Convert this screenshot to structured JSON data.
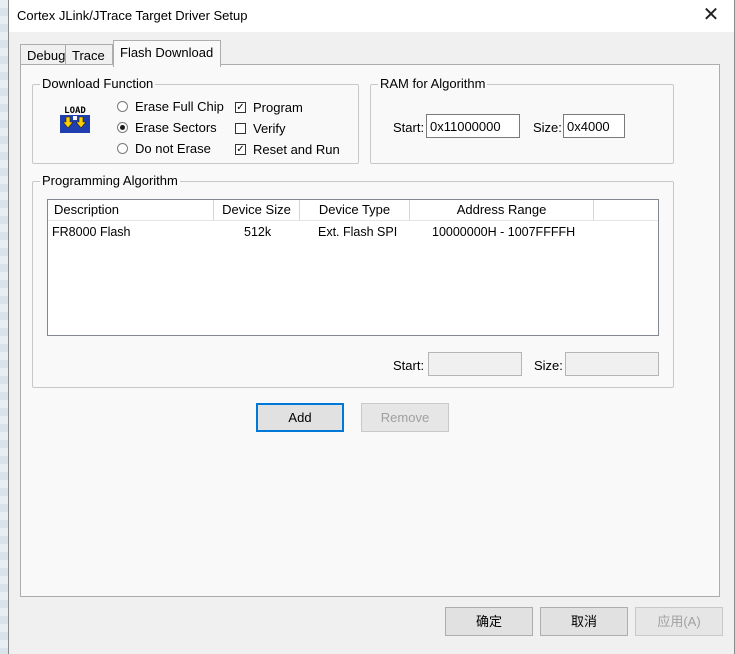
{
  "window": {
    "title": "Cortex JLink/JTrace Target Driver Setup",
    "close_glyph": "✕"
  },
  "tabs": [
    {
      "label": "Debug"
    },
    {
      "label": "Trace"
    },
    {
      "label": "Flash Download"
    }
  ],
  "download_function": {
    "title": "Download Function",
    "icon_text": "LOAD",
    "radios": [
      {
        "label": "Erase Full Chip",
        "selected": false
      },
      {
        "label": "Erase Sectors",
        "selected": true
      },
      {
        "label": "Do not Erase",
        "selected": false
      }
    ],
    "checks": [
      {
        "label": "Program",
        "checked": true
      },
      {
        "label": "Verify",
        "checked": false
      },
      {
        "label": "Reset and Run",
        "checked": true
      }
    ]
  },
  "ram": {
    "title": "RAM for Algorithm",
    "start_label": "Start:",
    "start_value": "0x11000000",
    "size_label": "Size:",
    "size_value": "0x4000"
  },
  "algorithm": {
    "title": "Programming Algorithm",
    "columns": [
      "Description",
      "Device Size",
      "Device Type",
      "Address Range"
    ],
    "rows": [
      {
        "description": "FR8000 Flash",
        "size": "512k",
        "type": "Ext. Flash SPI",
        "range": "10000000H - 1007FFFFH"
      }
    ],
    "start_label": "Start:",
    "start_value": "",
    "size_label": "Size:",
    "size_value": ""
  },
  "buttons": {
    "add": "Add",
    "remove": "Remove"
  },
  "footer": {
    "ok": "确定",
    "cancel": "取消",
    "apply": "应用(A)"
  },
  "checkmark_glyph": "✓",
  "colors": {
    "accent": "#0078d7",
    "panel": "#f9f9f9",
    "dialog": "#f0f0f0"
  }
}
